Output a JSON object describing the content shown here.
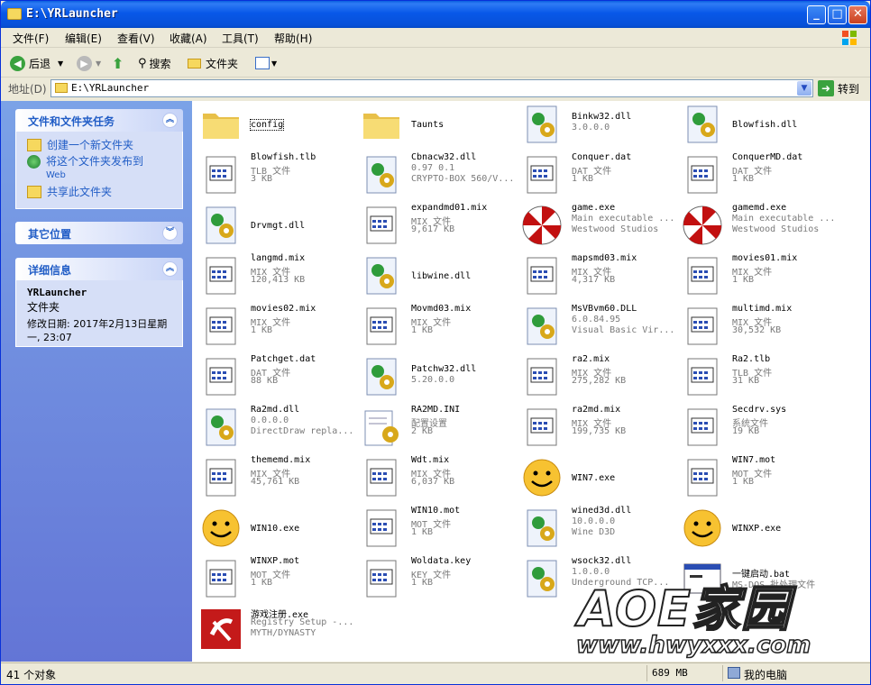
{
  "window": {
    "title": "E:\\YRLauncher",
    "buttons": [
      "_",
      "□",
      "✕"
    ]
  },
  "menu": [
    "文件(F)",
    "编辑(E)",
    "查看(V)",
    "收藏(A)",
    "工具(T)",
    "帮助(H)"
  ],
  "toolbar": {
    "back": "后退",
    "search": "搜索",
    "folders": "文件夹"
  },
  "address": {
    "label": "地址(D)",
    "value": "E:\\YRLauncher",
    "go": "转到"
  },
  "tasks": {
    "header": "文件和文件夹任务",
    "items": [
      {
        "label": "创建一个新文件夹",
        "icon": "new-folder-icon"
      },
      {
        "label": "将这个文件夹发布到",
        "extra": "Web",
        "icon": "globe-icon"
      },
      {
        "label": "共享此文件夹",
        "icon": "share-folder-icon"
      }
    ]
  },
  "other_places": {
    "header": "其它位置"
  },
  "details": {
    "header": "详细信息",
    "name": "YRLauncher",
    "type": "文件夹",
    "modified": "修改日期: 2017年2月13日星期一, 23:07"
  },
  "files": [
    {
      "name": "config",
      "line1": "",
      "line2": "",
      "icon": "folder"
    },
    {
      "name": "Taunts",
      "line1": "",
      "line2": "",
      "icon": "folder"
    },
    {
      "name": "Binkw32.dll",
      "line1": "3.0.0.0",
      "line2": "",
      "icon": "dll"
    },
    {
      "name": "Blowfish.dll",
      "line1": "",
      "line2": "",
      "icon": "dll"
    },
    {
      "name": "Blowfish.tlb",
      "line1": "TLB 文件",
      "line2": "3 KB",
      "icon": "doc"
    },
    {
      "name": "Cbnacw32.dll",
      "line1": "0.97 0.1",
      "line2": "CRYPTO-BOX 560/V...",
      "icon": "dll"
    },
    {
      "name": "Conquer.dat",
      "line1": "DAT 文件",
      "line2": "1 KB",
      "icon": "doc"
    },
    {
      "name": "ConquerMD.dat",
      "line1": "DAT 文件",
      "line2": "1 KB",
      "icon": "doc"
    },
    {
      "name": "Drvmgt.dll",
      "line1": "",
      "line2": "",
      "icon": "dll"
    },
    {
      "name": "expandmd01.mix",
      "line1": "MIX 文件",
      "line2": "9,617 KB",
      "icon": "doc"
    },
    {
      "name": "game.exe",
      "line1": "Main executable ...",
      "line2": "Westwood Studios",
      "icon": "umbrella"
    },
    {
      "name": "gamemd.exe",
      "line1": "Main executable ...",
      "line2": "Westwood Studios",
      "icon": "umbrella"
    },
    {
      "name": "langmd.mix",
      "line1": "MIX 文件",
      "line2": "120,413 KB",
      "icon": "doc"
    },
    {
      "name": "libwine.dll",
      "line1": "",
      "line2": "",
      "icon": "dll"
    },
    {
      "name": "mapsmd03.mix",
      "line1": "MIX 文件",
      "line2": "4,317 KB",
      "icon": "doc"
    },
    {
      "name": "movies01.mix",
      "line1": "MIX 文件",
      "line2": "1 KB",
      "icon": "doc"
    },
    {
      "name": "movies02.mix",
      "line1": "MIX 文件",
      "line2": "1 KB",
      "icon": "doc"
    },
    {
      "name": "Movmd03.mix",
      "line1": "MIX 文件",
      "line2": "1 KB",
      "icon": "doc"
    },
    {
      "name": "MsVBvm60.DLL",
      "line1": "6.0.84.95",
      "line2": "Visual Basic Vir...",
      "icon": "dll"
    },
    {
      "name": "multimd.mix",
      "line1": "MIX 文件",
      "line2": "30,532 KB",
      "icon": "doc"
    },
    {
      "name": "Patchget.dat",
      "line1": "DAT 文件",
      "line2": "88 KB",
      "icon": "doc"
    },
    {
      "name": "Patchw32.dll",
      "line1": "5.20.0.0",
      "line2": "",
      "icon": "dll"
    },
    {
      "name": "ra2.mix",
      "line1": "MIX 文件",
      "line2": "275,282 KB",
      "icon": "doc"
    },
    {
      "name": "Ra2.tlb",
      "line1": "TLB 文件",
      "line2": "31 KB",
      "icon": "doc"
    },
    {
      "name": "Ra2md.dll",
      "line1": "0.0.0.0",
      "line2": "DirectDraw repla...",
      "icon": "dll"
    },
    {
      "name": "RA2MD.INI",
      "line1": "配置设置",
      "line2": "2 KB",
      "icon": "ini"
    },
    {
      "name": "ra2md.mix",
      "line1": "MIX 文件",
      "line2": "199,735 KB",
      "icon": "doc"
    },
    {
      "name": "Secdrv.sys",
      "line1": "系统文件",
      "line2": "19 KB",
      "icon": "doc"
    },
    {
      "name": "thememd.mix",
      "line1": "MIX 文件",
      "line2": "45,761 KB",
      "icon": "doc"
    },
    {
      "name": "Wdt.mix",
      "line1": "MIX 文件",
      "line2": "6,037 KB",
      "icon": "doc"
    },
    {
      "name": "WIN7.exe",
      "line1": "",
      "line2": "",
      "icon": "smiley"
    },
    {
      "name": "WIN7.mot",
      "line1": "MOT 文件",
      "line2": "1 KB",
      "icon": "doc"
    },
    {
      "name": "WIN10.exe",
      "line1": "",
      "line2": "",
      "icon": "smiley"
    },
    {
      "name": "WIN10.mot",
      "line1": "MOT 文件",
      "line2": "1 KB",
      "icon": "doc"
    },
    {
      "name": "wined3d.dll",
      "line1": "10.0.0.0",
      "line2": "Wine D3D",
      "icon": "dll"
    },
    {
      "name": "WINXP.exe",
      "line1": "",
      "line2": "",
      "icon": "smiley"
    },
    {
      "name": "WINXP.mot",
      "line1": "MOT 文件",
      "line2": "1 KB",
      "icon": "doc"
    },
    {
      "name": "Woldata.key",
      "line1": "KEY 文件",
      "line2": "1 KB",
      "icon": "doc"
    },
    {
      "name": "wsock32.dll",
      "line1": "1.0.0.0",
      "line2": "Underground TCP...",
      "icon": "dll"
    },
    {
      "name": "一键启动.bat",
      "line1": "MS-DOS 批处理文件",
      "line2": "",
      "icon": "bat"
    },
    {
      "name": "游戏注册.exe",
      "line1": "Registry Setup -...",
      "line2": "MYTH/DYNASTY",
      "icon": "sickle"
    }
  ],
  "status": {
    "count": "41 个对象",
    "size": "689 MB",
    "location": "我的电脑"
  },
  "watermark": {
    "main": "AOE家园",
    "url": "www.hwyxxx.com"
  }
}
